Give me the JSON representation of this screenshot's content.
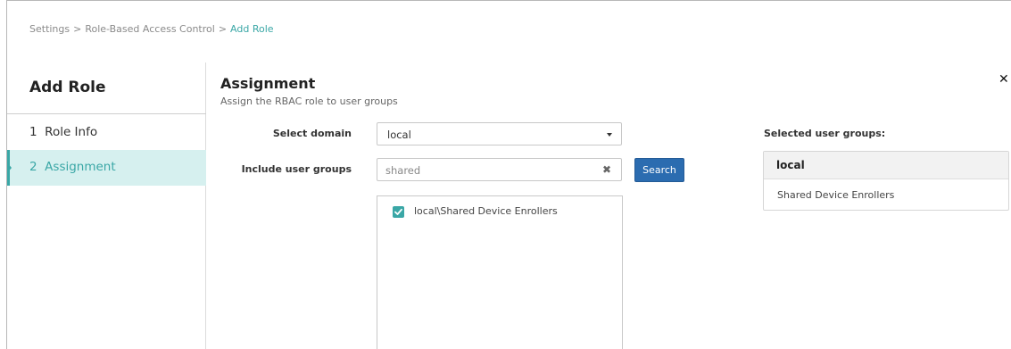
{
  "breadcrumb": {
    "items": [
      "Settings",
      "Role-Based Access Control",
      "Add Role"
    ],
    "separator": ">"
  },
  "sidebar": {
    "title": "Add Role",
    "steps": [
      {
        "label": "1  Role Info",
        "active": false
      },
      {
        "label": "2  Assignment",
        "active": true
      }
    ]
  },
  "main": {
    "title": "Assignment",
    "subtitle": "Assign the RBAC role to user groups",
    "close_icon": "close-icon",
    "select_domain_label": "Select domain",
    "domain_value": "local",
    "include_groups_label": "Include user groups",
    "search_value": "shared",
    "search_button_label": "Search",
    "results": [
      {
        "label": "local\\Shared Device Enrollers",
        "checked": true
      }
    ]
  },
  "selected": {
    "heading": "Selected user groups:",
    "domain": "local",
    "items": [
      "Shared Device Enrollers"
    ]
  },
  "colors": {
    "accent": "#3aa7a6",
    "active_bg": "#d6f0ef",
    "button_blue": "#2b6cb0"
  }
}
